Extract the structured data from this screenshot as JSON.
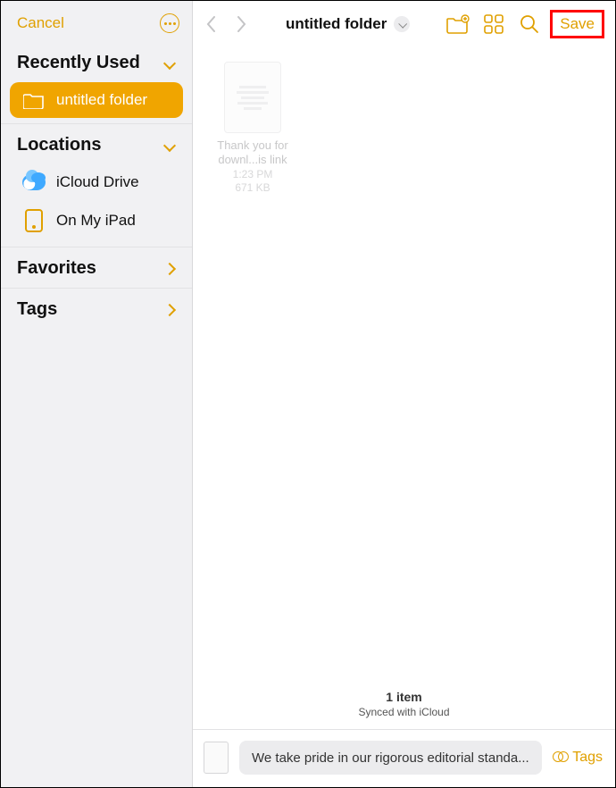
{
  "sidebar": {
    "cancel_label": "Cancel",
    "sections": {
      "recently_used": {
        "label": "Recently Used"
      },
      "locations": {
        "label": "Locations"
      },
      "favorites": {
        "label": "Favorites"
      },
      "tags": {
        "label": "Tags"
      }
    },
    "items": {
      "untitled_folder": {
        "label": "untitled folder"
      },
      "icloud_drive": {
        "label": "iCloud Drive"
      },
      "on_my_ipad": {
        "label": "On My iPad"
      }
    }
  },
  "toolbar": {
    "title": "untitled folder",
    "save_label": "Save"
  },
  "files": [
    {
      "name": "Thank you for downl...is link",
      "time": "1:23 PM",
      "size": "671 KB"
    }
  ],
  "footer": {
    "count_label": "1 item",
    "sync_label": "Synced with iCloud"
  },
  "name_bar": {
    "filename": "We take pride in our rigorous editorial standa...",
    "tags_label": "Tags"
  },
  "colors": {
    "accent": "#e0a000",
    "highlight": "#ff0000"
  }
}
